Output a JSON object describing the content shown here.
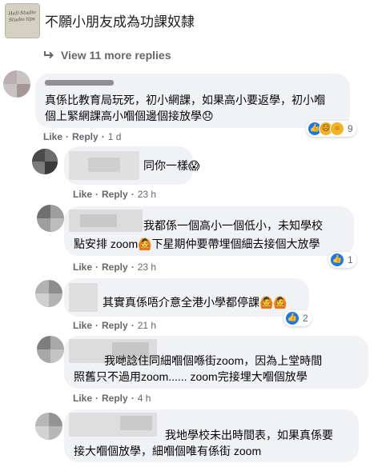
{
  "header": {
    "page_name": "不願小朋友成為功課奴隸",
    "avatar_scrawl": "Hell·Studio Studio tips"
  },
  "view_more": {
    "label": "View 11 more replies"
  },
  "colors": {
    "bubble": "#f0f2f5",
    "meta": "#65676b",
    "like_blue": "#1877f2",
    "sad_yellow": "#f7b125"
  },
  "comments": [
    {
      "lines": [
        "真係比教育局玩死，初小網課，如果高小要返學，初小嗰",
        "個上緊網課高小嗰個邊個接放學😞"
      ],
      "actions": {
        "like": "Like",
        "reply": "Reply",
        "time": "1 d"
      },
      "reactions": {
        "icons": [
          "like",
          "sad",
          "wow"
        ],
        "count": "9"
      }
    },
    {
      "lines": [
        "同你一樣😱"
      ],
      "actions": {
        "like": "Like",
        "reply": "Reply",
        "time": "23 h"
      }
    },
    {
      "lines": [
        "我都係一個高小一個低小，未知學校",
        "點安排 zoom🙆下星期仲要帶埋個細去接個大放學"
      ],
      "actions": {
        "like": "Like",
        "reply": "Reply",
        "time": "23 h"
      },
      "reactions": {
        "icons": [
          "like"
        ],
        "count": "1"
      }
    },
    {
      "lines": [
        "其實真係唔介意全港小學都停課🙆🙆"
      ],
      "actions": {
        "like": "Like",
        "reply": "Reply",
        "time": "21 h"
      },
      "reactions": {
        "icons": [
          "like"
        ],
        "count": "2"
      }
    },
    {
      "lines": [
        "我哋諗住同細嗰個喺街zoom，因為上堂時間",
        "照舊只不過用zoom...... zoom完接埋大嗰個放學"
      ],
      "actions": {
        "like": "Like",
        "reply": "Reply",
        "time": "4 h"
      }
    },
    {
      "lines": [
        "我地學校未出時間表，如果真係要",
        "接大嗰個放學，細嗰個唯有係街 zoom"
      ]
    }
  ]
}
